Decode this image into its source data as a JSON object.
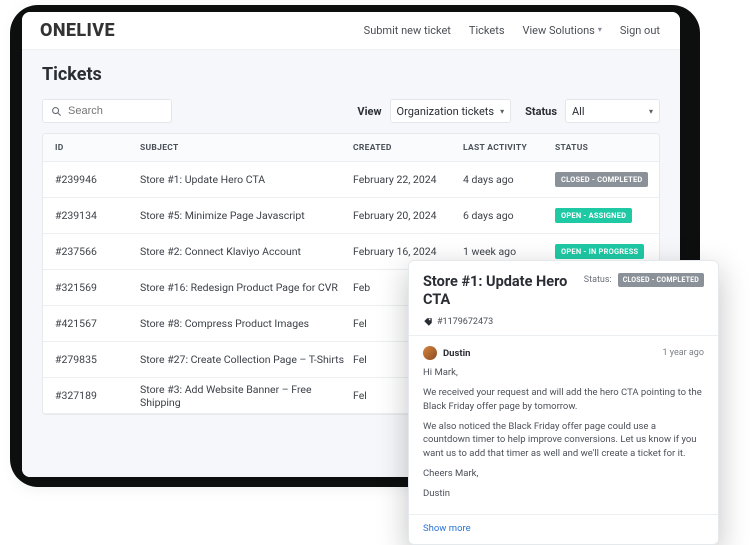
{
  "brand": "ONELIVE",
  "nav": {
    "submit": "Submit new ticket",
    "tickets": "Tickets",
    "solutions": "View Solutions",
    "signout": "Sign out"
  },
  "page_title": "Tickets",
  "search": {
    "placeholder": "Search"
  },
  "toolbar": {
    "view_label": "View",
    "view_value": "Organization tickets",
    "status_label": "Status",
    "status_value": "All"
  },
  "columns": {
    "id": "ID",
    "subject": "SUBJECT",
    "created": "CREATED",
    "activity": "LAST ACTIVITY",
    "status": "STATUS"
  },
  "rows": [
    {
      "id": "#239946",
      "subject": "Store #1: Update Hero CTA",
      "created": "February 22, 2024",
      "activity": "4 days ago",
      "status_text": "CLOSED - COMPLETED",
      "status_kind": "closed"
    },
    {
      "id": "#239134",
      "subject": "Store #5: Minimize Page Javascript",
      "created": "February 20, 2024",
      "activity": "6 days ago",
      "status_text": "OPEN - ASSIGNED",
      "status_kind": "open"
    },
    {
      "id": "#237566",
      "subject": "Store #2: Connect Klaviyo Account",
      "created": "February 16, 2024",
      "activity": "1 week ago",
      "status_text": "OPEN - IN PROGRESS",
      "status_kind": "open"
    },
    {
      "id": "#321569",
      "subject": "Store #16: Redesign Product Page for CVR",
      "created": "Feb",
      "activity": "",
      "status_text": "",
      "status_kind": ""
    },
    {
      "id": "#421567",
      "subject": "Store #8: Compress Product Images",
      "created": "Fel",
      "activity": "",
      "status_text": "",
      "status_kind": ""
    },
    {
      "id": "#279835",
      "subject": "Store #27: Create Collection Page – T-Shirts",
      "created": "Fel",
      "activity": "",
      "status_text": "",
      "status_kind": ""
    },
    {
      "id": "#327189",
      "subject": "Store #3: Add Website Banner – Free Shipping",
      "created": "Fel",
      "activity": "",
      "status_text": "",
      "status_kind": ""
    }
  ],
  "detail": {
    "title": "Store #1: Update Hero CTA",
    "status_label": "Status:",
    "status_text": "CLOSED - COMPLETED",
    "ticket_no": "#1179672473",
    "author": "Dustin",
    "when": "1 year ago",
    "body_p1": "Hi Mark,",
    "body_p2": "We received your request and will add the hero CTA pointing to the Black Friday offer page by tomorrow.",
    "body_p3": "We also noticed the Black Friday offer page could use a countdown timer to help improve conversions. Let us know if you want us to add that timer as well and we'll create a ticket for it.",
    "body_p4": "Cheers Mark,",
    "body_p5": "Dustin",
    "show_more": "Show more"
  }
}
